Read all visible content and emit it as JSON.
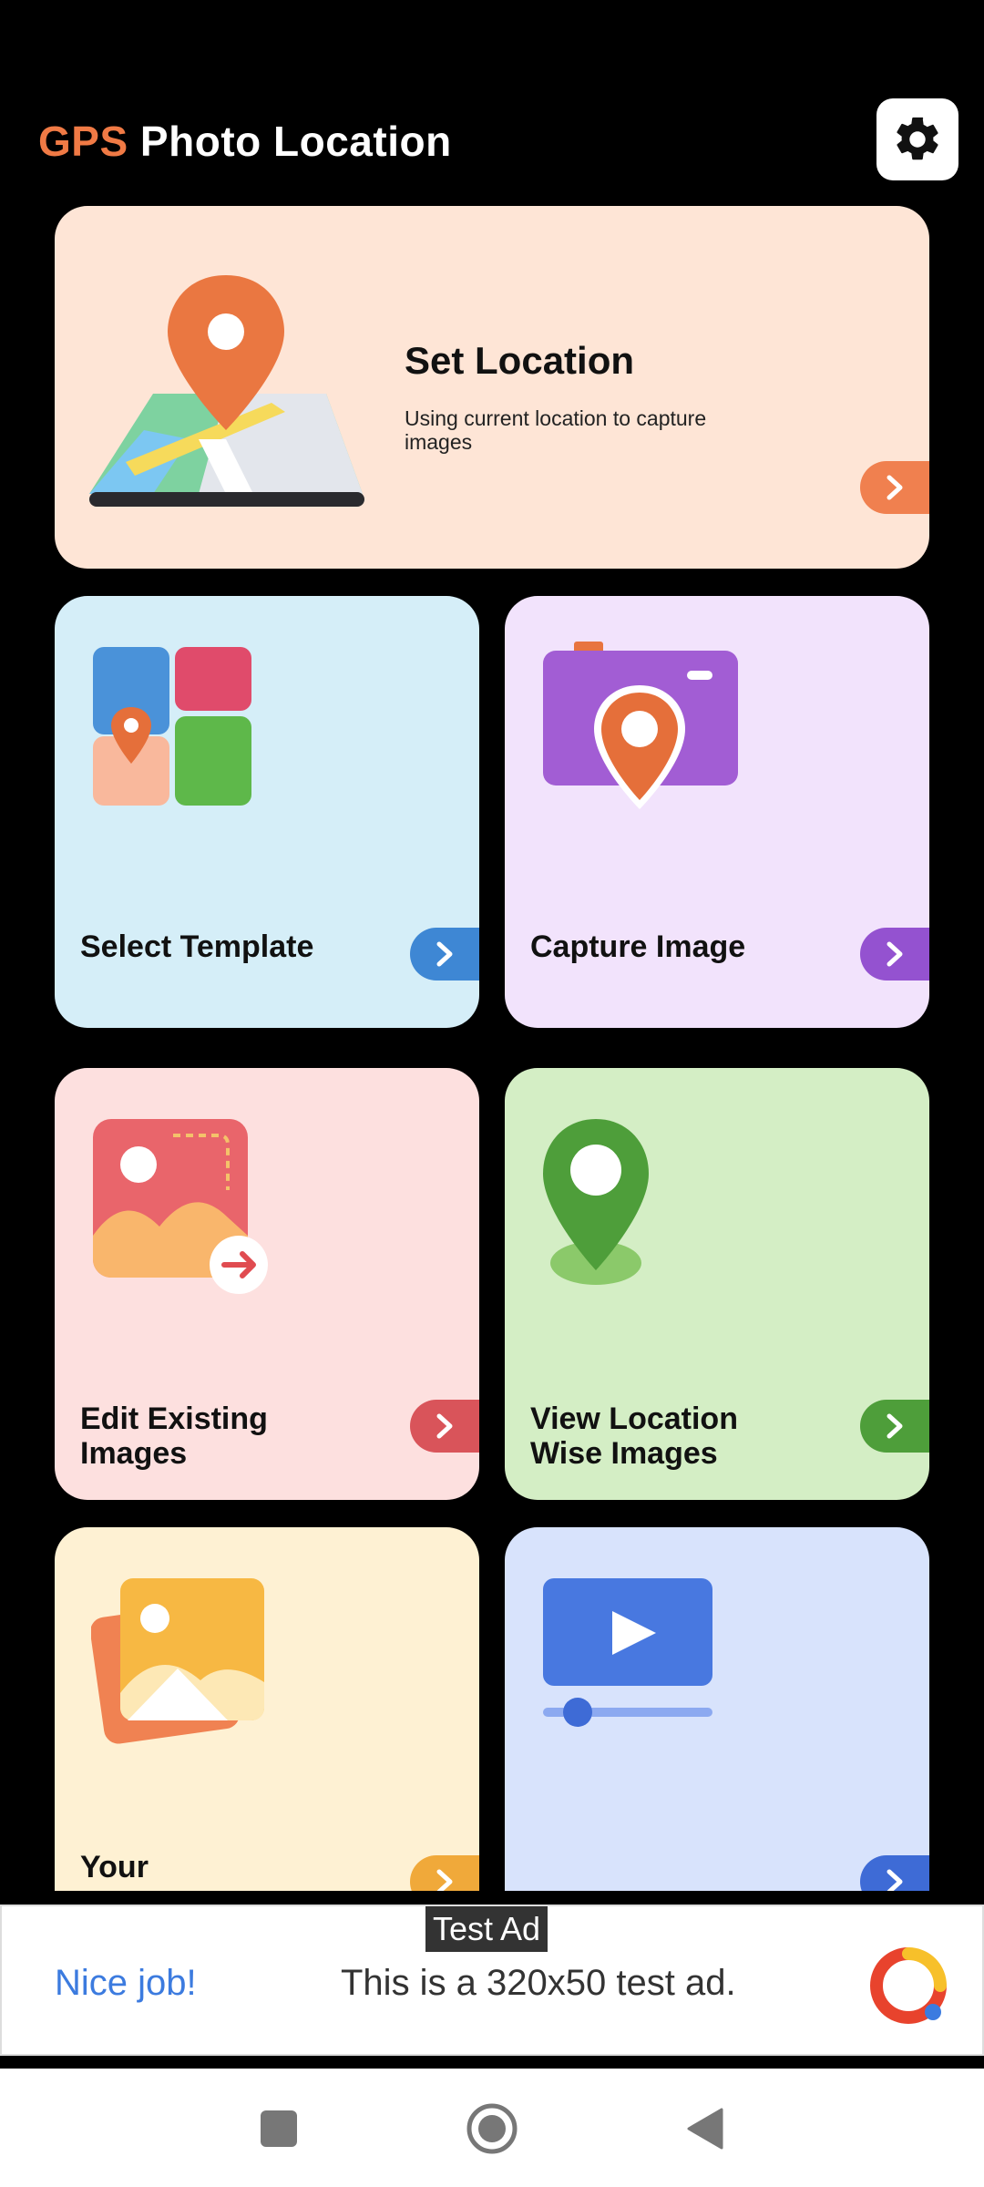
{
  "header": {
    "title_accent": "GPS",
    "title_rest": " Photo Location"
  },
  "icons": {
    "settings": "gear-icon",
    "arrow": "chevron-right-icon"
  },
  "colors": {
    "accent": "#F07A45",
    "set_location_bg": "#FEE5D6",
    "template_bg": "#D5EEF8",
    "capture_bg": "#F2E3FC",
    "edit_bg": "#FDE0DF",
    "view_bg": "#D4EEC5",
    "your_bg": "#FEF1D3",
    "video_bg": "#D8E3FC"
  },
  "cards": {
    "set_location": {
      "title": "Set Location",
      "subtitle": "Using current location to capture images"
    },
    "select_template": {
      "title": "Select Template"
    },
    "capture_image": {
      "title": "Capture Image"
    },
    "edit_existing": {
      "title": "Edit Existing Images"
    },
    "view_location": {
      "title": "View Location Wise Images"
    },
    "your": {
      "title": "Your"
    }
  },
  "ad": {
    "tag": "Test Ad",
    "cta": "Nice job!",
    "text": "This is a 320x50 test ad."
  }
}
